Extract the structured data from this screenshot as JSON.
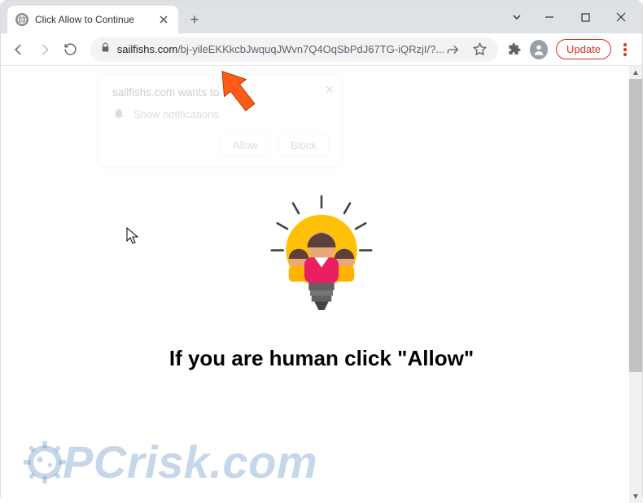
{
  "tab": {
    "title": "Click Allow to Continue"
  },
  "window_controls": {
    "dropdown": "⌄",
    "minimize": "—",
    "maximize": "▢",
    "close": "✕"
  },
  "toolbar": {
    "back": "←",
    "forward": "→",
    "reload": "↻",
    "lock": "🔒",
    "domain": "sailfishs.com",
    "path": "/bj-yileEKKkcbJwquqJWvn7Q4OqSbPdJ67TG-iQRzjI/?...",
    "share": "↗",
    "star": "☆",
    "update_label": "Update",
    "ext": "🧩"
  },
  "notification": {
    "title": "sailfishs.com wants to",
    "permission": "Show notifications",
    "allow": "Allow",
    "block": "Block",
    "close": "×"
  },
  "page": {
    "headline": "If you are human click \"Allow\""
  },
  "watermark": {
    "text": "PCrisk.com"
  },
  "colors": {
    "accent": "#d93025",
    "bulb": "#ffc107",
    "face": "#e8a87c",
    "hair": "#5d4037",
    "shirt1": "#e91e63",
    "shirt2": "#ffb300"
  }
}
